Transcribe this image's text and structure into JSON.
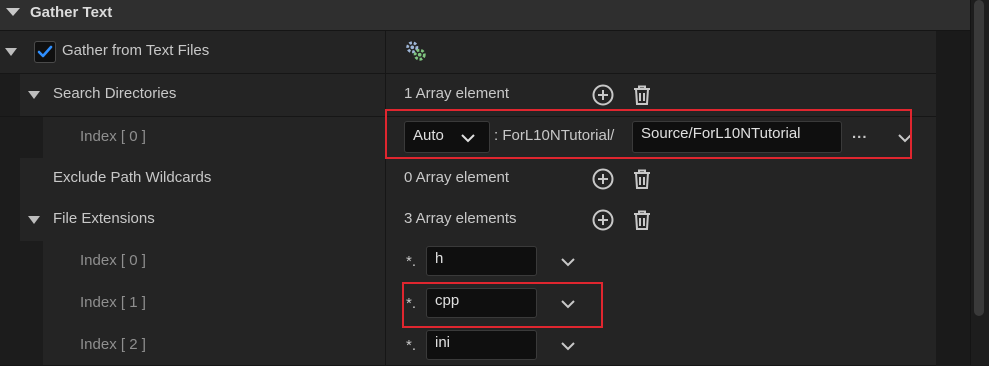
{
  "section": {
    "title": "Gather Text"
  },
  "gather_from_text_files": {
    "label": "Gather from Text Files",
    "checked": true
  },
  "search_directories": {
    "label": "Search Directories",
    "count_text": "1 Array element",
    "index0": {
      "label": "Index [ 0 ]",
      "root_select": "Auto",
      "prefix": ": ForL10NTutorial/",
      "path_value": "Source/ForL10NTutorial",
      "browse_label": "..."
    }
  },
  "exclude_path_wildcards": {
    "label": "Exclude Path Wildcards",
    "count_text": "0 Array element"
  },
  "file_extensions": {
    "label": "File Extensions",
    "count_text": "3 Array elements",
    "items": [
      {
        "label": "Index [ 0 ]",
        "prefix": "*.",
        "value": "h"
      },
      {
        "label": "Index [ 1 ]",
        "prefix": "*.",
        "value": "cpp"
      },
      {
        "label": "Index [ 2 ]",
        "prefix": "*.",
        "value": "ini"
      }
    ]
  },
  "colors": {
    "highlight": "#e0262f",
    "checkbox_check": "#2f8fff",
    "background": "#1a1a1a"
  }
}
